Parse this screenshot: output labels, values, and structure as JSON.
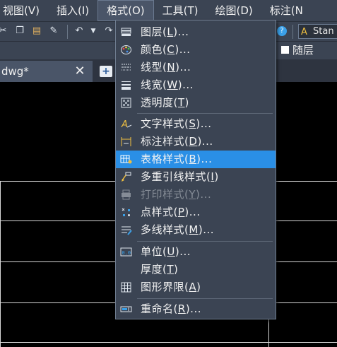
{
  "menubar": {
    "items": [
      {
        "label": "视图(V)"
      },
      {
        "label": "插入(I)"
      },
      {
        "label": "格式(O)"
      },
      {
        "label": "工具(T)"
      },
      {
        "label": "绘图(D)"
      },
      {
        "label": "标注(N"
      }
    ]
  },
  "toolbar": {
    "text_style_value": "Stan"
  },
  "propbar": {
    "linetype_value": "随层"
  },
  "tabs": {
    "file_label": "dwg*",
    "close_glyph": "✕",
    "new_glyph": "+"
  },
  "format_menu": {
    "items": [
      {
        "text": "图层",
        "key": "L",
        "suffix": "...",
        "icon": "layers-icon"
      },
      {
        "text": "颜色",
        "key": "C",
        "suffix": "...",
        "icon": "color-palette-icon"
      },
      {
        "text": "线型",
        "key": "N",
        "suffix": "...",
        "icon": "linetype-icon"
      },
      {
        "text": "线宽",
        "key": "W",
        "suffix": "...",
        "icon": "lineweight-icon"
      },
      {
        "text": "透明度",
        "key": "T",
        "suffix": "",
        "icon": "transparency-icon"
      },
      {
        "text": "文字样式",
        "key": "S",
        "suffix": "...",
        "icon": "text-style-icon"
      },
      {
        "text": "标注样式",
        "key": "D",
        "suffix": "...",
        "icon": "dimension-style-icon"
      },
      {
        "text": "表格样式",
        "key": "B",
        "suffix": "...",
        "icon": "table-style-icon"
      },
      {
        "text": "多重引线样式",
        "key": "I",
        "suffix": "",
        "icon": "multileader-style-icon"
      },
      {
        "text": "打印样式",
        "key": "Y",
        "suffix": "...",
        "icon": "plot-style-icon"
      },
      {
        "text": "点样式",
        "key": "P",
        "suffix": "...",
        "icon": "point-style-icon"
      },
      {
        "text": "多线样式",
        "key": "M",
        "suffix": "...",
        "icon": "multiline-style-icon"
      },
      {
        "text": "单位",
        "key": "U",
        "suffix": "...",
        "icon": "units-icon"
      },
      {
        "text": "厚度",
        "key": "T",
        "suffix": "",
        "icon": "thickness-icon"
      },
      {
        "text": "图形界限",
        "key": "A",
        "suffix": "",
        "icon": "drawing-limits-icon"
      },
      {
        "text": "重命名",
        "key": "R",
        "suffix": "...",
        "icon": "rename-icon"
      }
    ],
    "highlighted": "表格样式",
    "disabled": "打印样式"
  },
  "colors": {
    "menu_bg": "#3b4453",
    "highlight": "#2a8fe6",
    "canvas": "#000000",
    "accent_icon": "#f0c040"
  }
}
